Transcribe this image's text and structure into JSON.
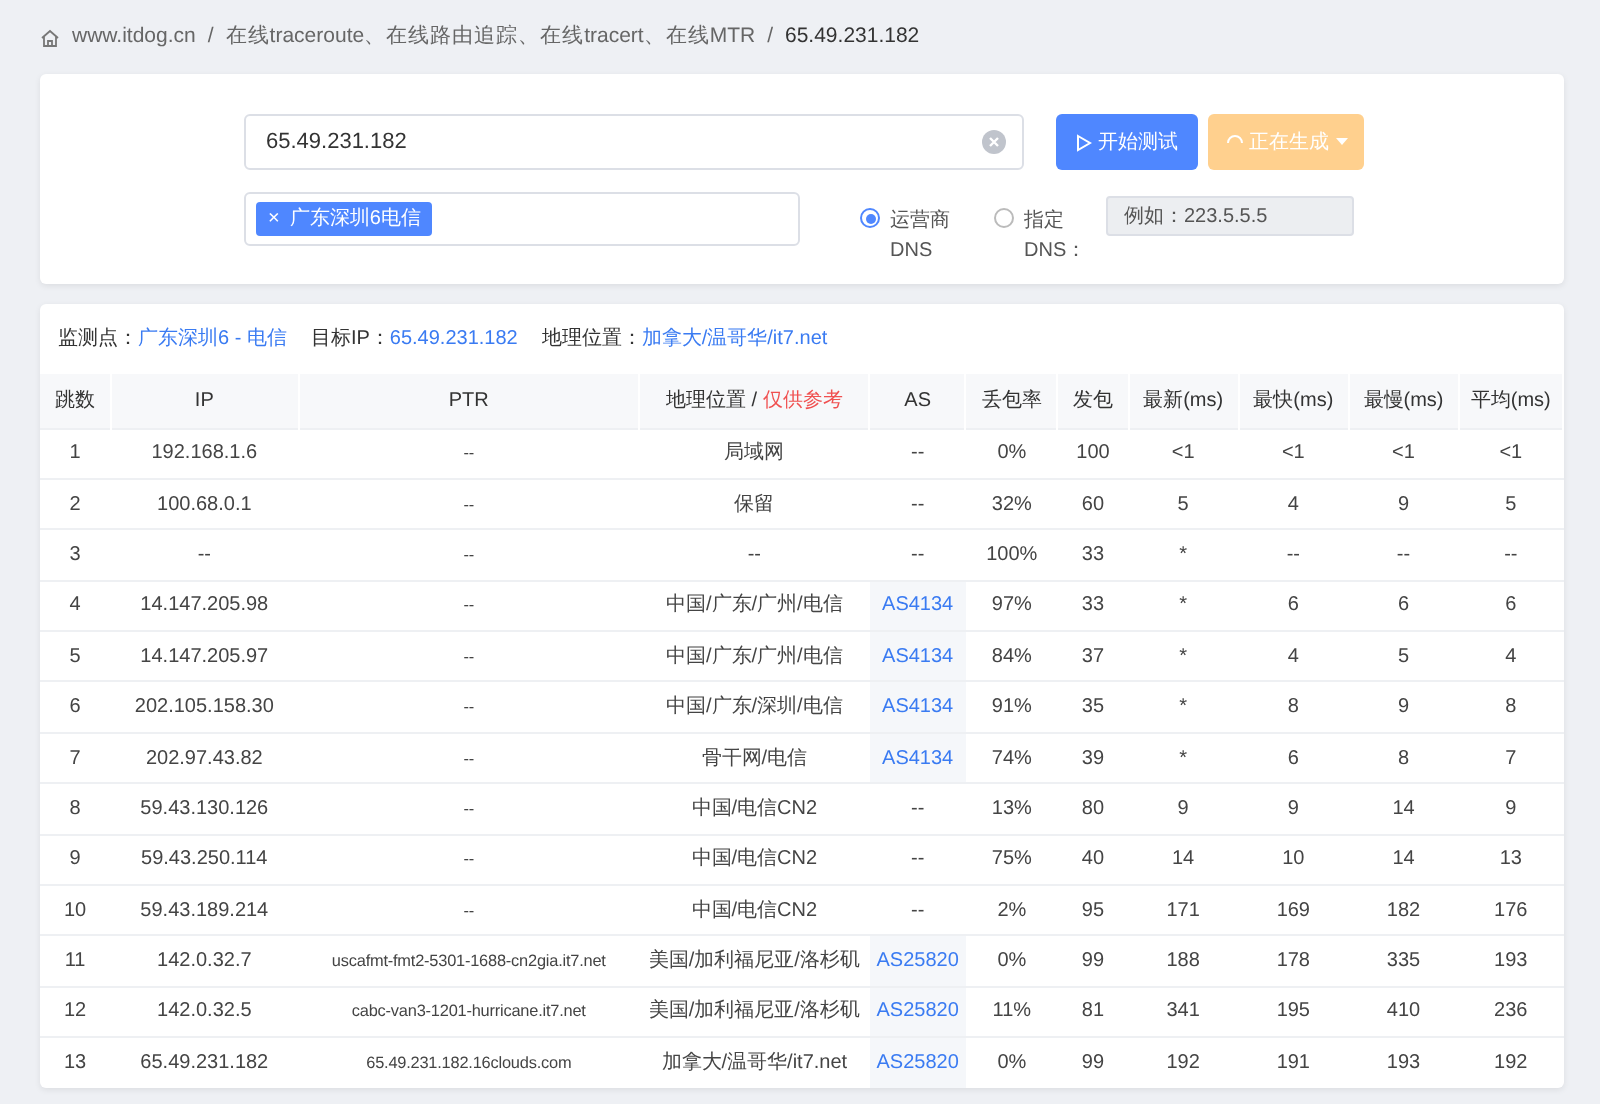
{
  "breadcrumb": {
    "separator": "/",
    "items": [
      "www.itdog.cn",
      "在线traceroute、在线路由追踪、在线tracert、在线MTR",
      "65.49.231.182"
    ]
  },
  "form": {
    "target": {
      "value": "65.49.231.182"
    },
    "start_button": "开始测试",
    "generate_button": {
      "label": "正在生成",
      "disabled": true
    },
    "nodes": [
      {
        "label": "广东深圳6电信",
        "remove": "×"
      }
    ],
    "dns_options": [
      {
        "label": "运营商 DNS",
        "selected": true
      },
      {
        "label": "指定 DNS：",
        "selected": false
      }
    ],
    "dns_field": {
      "placeholder": "例如：223.5.5.5",
      "disabled": true
    }
  },
  "info": [
    {
      "label": "监测点：",
      "value": "广东深圳6 - 电信"
    },
    {
      "label": "目标IP：",
      "value": "65.49.231.182"
    },
    {
      "label": "地理位置：",
      "value": "加拿大/温哥华/it7.net"
    }
  ],
  "table": {
    "columns": [
      "跳数",
      "IP",
      "PTR",
      "地理位置 /",
      "AS",
      "丢包率",
      "发包",
      "最新(ms)",
      "最快(ms)",
      "最慢(ms)",
      "平均(ms)"
    ],
    "geo_note": "仅供参考",
    "rows": [
      [
        "1",
        "192.168.1.6",
        "--",
        "局域网",
        "--",
        "0%",
        "100",
        "<1",
        "<1",
        "<1",
        "<1"
      ],
      [
        "2",
        "100.68.0.1",
        "--",
        "保留",
        "--",
        "32%",
        "60",
        "5",
        "4",
        "9",
        "5"
      ],
      [
        "3",
        "--",
        "--",
        "--",
        "--",
        "100%",
        "33",
        "*",
        "--",
        "--",
        "--"
      ],
      [
        "4",
        "14.147.205.98",
        "--",
        "中国/广东/广州/电信",
        "AS4134",
        "97%",
        "33",
        "*",
        "6",
        "6",
        "6"
      ],
      [
        "5",
        "14.147.205.97",
        "--",
        "中国/广东/广州/电信",
        "AS4134",
        "84%",
        "37",
        "*",
        "4",
        "5",
        "4"
      ],
      [
        "6",
        "202.105.158.30",
        "--",
        "中国/广东/深圳/电信",
        "AS4134",
        "91%",
        "35",
        "*",
        "8",
        "9",
        "8"
      ],
      [
        "7",
        "202.97.43.82",
        "--",
        "骨干网/电信",
        "AS4134",
        "74%",
        "39",
        "*",
        "6",
        "8",
        "7"
      ],
      [
        "8",
        "59.43.130.126",
        "--",
        "中国/电信CN2",
        "--",
        "13%",
        "80",
        "9",
        "9",
        "14",
        "9"
      ],
      [
        "9",
        "59.43.250.114",
        "--",
        "中国/电信CN2",
        "--",
        "75%",
        "40",
        "14",
        "10",
        "14",
        "13"
      ],
      [
        "10",
        "59.43.189.214",
        "--",
        "中国/电信CN2",
        "--",
        "2%",
        "95",
        "171",
        "169",
        "182",
        "176"
      ],
      [
        "11",
        "142.0.32.7",
        "uscafmt-fmt2-5301-1688-cn2gia.it7.net",
        "美国/加利福尼亚/洛杉矶",
        "AS25820",
        "0%",
        "99",
        "188",
        "178",
        "335",
        "193"
      ],
      [
        "12",
        "142.0.32.5",
        "cabc-van3-1201-hurricane.it7.net",
        "美国/加利福尼亚/洛杉矶",
        "AS25820",
        "11%",
        "81",
        "341",
        "195",
        "410",
        "236"
      ],
      [
        "13",
        "65.49.231.182",
        "65.49.231.182.16clouds.com",
        "加拿大/温哥华/it7.net",
        "AS25820",
        "0%",
        "99",
        "192",
        "191",
        "193",
        "192"
      ]
    ],
    "linked_as": [
      false,
      false,
      false,
      true,
      true,
      true,
      true,
      false,
      false,
      false,
      true,
      true,
      true
    ]
  }
}
